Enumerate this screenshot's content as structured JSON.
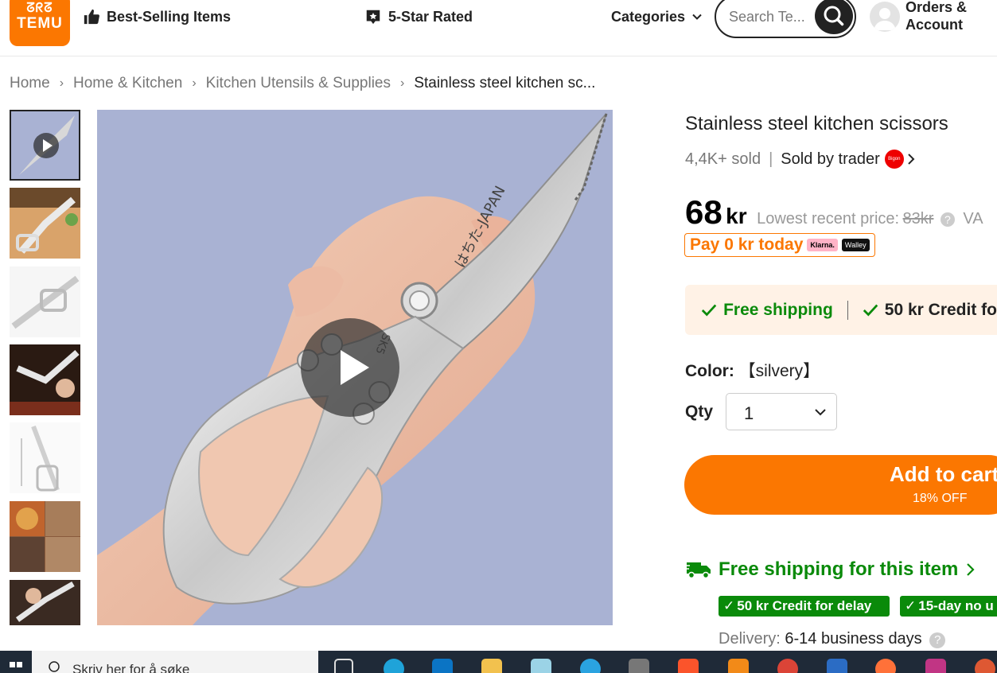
{
  "header": {
    "logo_text": "TEMU",
    "logo_icons": "ᘔᖇᘔ",
    "nav": {
      "best_selling": "Best-Selling Items",
      "five_star": "5-Star Rated",
      "categories": "Categories"
    },
    "search_placeholder": "Search Te...",
    "account_line1": "Orders &",
    "account_line2": "Account"
  },
  "breadcrumb": [
    "Home",
    "Home & Kitchen",
    "Kitchen Utensils & Supplies",
    "Stainless steel kitchen sc..."
  ],
  "thumbnails": [
    {
      "name": "thumb-video",
      "selected": true
    },
    {
      "name": "thumb-2"
    },
    {
      "name": "thumb-3"
    },
    {
      "name": "thumb-4"
    },
    {
      "name": "thumb-5"
    },
    {
      "name": "thumb-6"
    },
    {
      "name": "thumb-7"
    }
  ],
  "product": {
    "title": "Stainless steel kitchen scissors",
    "sold": "4,4K+ sold",
    "sold_by": "Sold by trader",
    "seller_badge_text": "Bigon",
    "price": "68",
    "currency": "kr",
    "lowest_label": "Lowest recent price:",
    "lowest_price": "83kr",
    "vat_truncated": "VA",
    "pay_today": "Pay 0 kr today",
    "klarna": "Klarna.",
    "walley": "Walley",
    "free_shipping": "Free shipping",
    "credit": "50 kr Credit fo",
    "color_label": "Color:",
    "color_value": "【silvery】",
    "qty_label": "Qty",
    "qty_value": "1",
    "cart_label": "Add to cart",
    "cart_discount": "18% OFF",
    "fs_item": "Free shipping for this item",
    "badge1": "50 kr Credit for delay",
    "badge2": "15-day no u",
    "delivery_label": "Delivery:",
    "delivery_value": "6-14 business days"
  },
  "image_text": {
    "blade_text": "はちた-JAPAN",
    "steel_text": "SK5"
  },
  "taskbar": {
    "search_placeholder": "Skriv her for å søke"
  },
  "colors": {
    "brand": "#fb7701",
    "green": "#0a8a0a",
    "image_bg": "#a9b2d3"
  }
}
